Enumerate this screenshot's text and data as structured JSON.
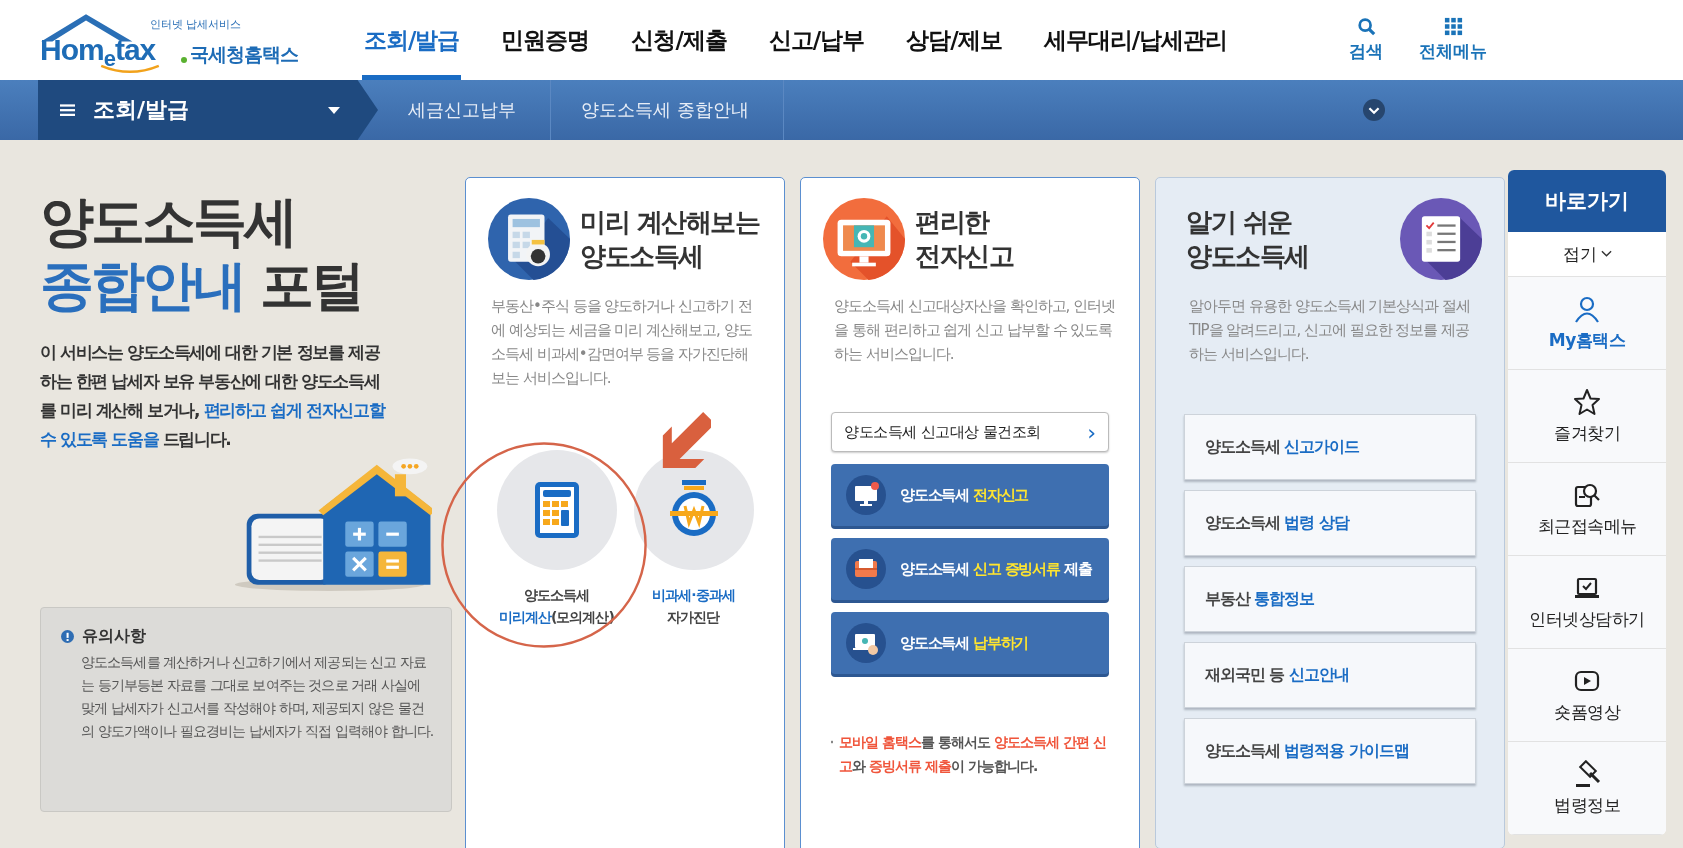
{
  "logo": {
    "tagline": "인터넷 납세서비스",
    "wordmark_start": "Hom",
    "wordmark_e": "e",
    "wordmark_end": "tax",
    "name": "국세청홈택스"
  },
  "main_nav": [
    {
      "label": "조회/발급",
      "selected": true
    },
    {
      "label": "민원증명",
      "selected": false
    },
    {
      "label": "신청/제출",
      "selected": false
    },
    {
      "label": "신고/납부",
      "selected": false
    },
    {
      "label": "상담/제보",
      "selected": false
    },
    {
      "label": "세무대리/납세관리",
      "selected": false
    }
  ],
  "header_tools": [
    {
      "label": "검색"
    },
    {
      "label": "전체메뉴"
    }
  ],
  "menu_bar": {
    "menu": "조회/발급",
    "breadcrumbs": [
      "세금신고납부",
      "양도소득세 종합안내"
    ]
  },
  "intro": {
    "title_line1": "양도소득세",
    "title_line2": "**종합안내** 포털",
    "description": "이 서비스는 양도소득세에 대한 기본 정보를 제공하는 한편 납세자 보유 부동산에 대한 양도소득세를 미리 계산해 보거나, **편리하고 쉽게 전자신고할 수 있도록 도움을** 드립니다.",
    "notice_title": "유의사항",
    "notice_text": "양도소득세를 계산하거나 신고하기에서 제공되는 신고 자료는 등기부등본 자료를 그대로 보여주는 것으로 거래 사실에 맞게 납세자가 신고서를 작성해야 하며, 제공되지 않은 물건의 양도가액이나 필요경비는 납세자가 직접 입력해야 합니다."
  },
  "cards": [
    {
      "kind": "calc",
      "title_lines": [
        "미리 계산해보는",
        "양도소득세"
      ],
      "description": "부동산•주식 등을 양도하거나 신고하기 전에 예상되는 세금을 미리 계산해보고, 양도소득세 비과세•감면여부 등을 자가진단해보는 서비스입니다.",
      "items": [
        {
          "lines": [
            "양도소득세",
            "**미리계산**(모의계산)"
          ]
        },
        {
          "lines": [
            "**비과세·중과세**",
            "자가진단"
          ]
        }
      ]
    },
    {
      "kind": "efile",
      "title_lines": [
        "편리한",
        "전자신고"
      ],
      "description": "양도소득세 신고대상자산을 확인하고, 인터넷을 통해 편리하고 쉽게 신고 납부할 수 있도록 하는 서비스입니다.",
      "lookup": "양도소득세 신고대상 물건조회",
      "lookup_arrow": "›",
      "buttons": [
        {
          "label": "양도소득세 **전자신고**"
        },
        {
          "label": "양도소득세 **신고 증빙서류** 제출"
        },
        {
          "label": "양도소득세 **납부하기**"
        }
      ],
      "note": "**모바일 홈택스**를 통해서도 **양도소득세 간편 신고**와 **증빙서류 제출**이 가능합니다."
    },
    {
      "kind": "guide",
      "title_lines": [
        "알기 쉬운",
        "양도소득세"
      ],
      "description": "알아두면 유용한 양도소득세 기본상식과 절세 TIP을 알려드리고, 신고에 필요한 정보를 제공하는 서비스입니다.",
      "buttons": [
        {
          "label": "양도소득세 **신고가이드**"
        },
        {
          "label": "양도소득세 **법령 상담**"
        },
        {
          "label": "부동산 **통합정보**"
        },
        {
          "label": "재외국민 등 **신고안내**"
        },
        {
          "label": "양도소득세 **법령적용 가이드맵**"
        }
      ]
    }
  ],
  "quick_links": {
    "title": "바로가기",
    "collapse": "접기",
    "items": [
      {
        "label": "My홈택스",
        "selected": true
      },
      {
        "label": "즐겨찾기",
        "selected": false
      },
      {
        "label": "최근접속메뉴",
        "selected": false
      },
      {
        "label": "인터넷상담하기",
        "selected": false
      },
      {
        "label": "숏폼영상",
        "selected": false
      },
      {
        "label": "법령정보",
        "selected": false
      }
    ]
  },
  "annotations": [
    {
      "kind": "circle"
    },
    {
      "kind": "arrow"
    }
  ]
}
